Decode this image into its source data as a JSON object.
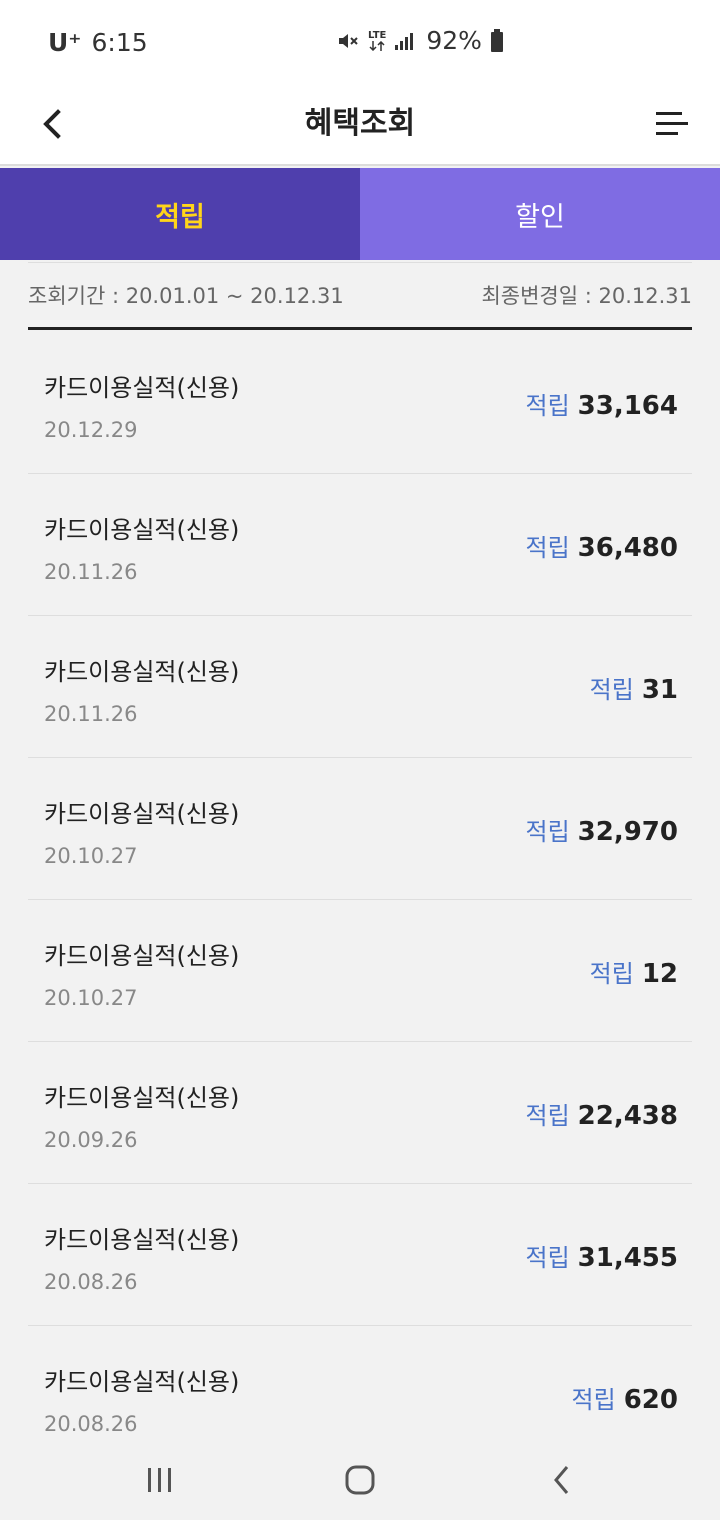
{
  "status_bar": {
    "carrier": "U⁺",
    "time": "6:15",
    "network": "LTE",
    "battery": "92%",
    "icons": [
      "mute-icon",
      "lte-icon",
      "signal-icon",
      "battery-icon"
    ]
  },
  "header": {
    "title": "혜택조회",
    "icons": [
      "back-icon",
      "menu-icon"
    ]
  },
  "tabs": [
    {
      "label": "적립",
      "active": true
    },
    {
      "label": "할인",
      "active": false
    }
  ],
  "period": {
    "range": "조회기간 : 20.01.01 ~ 20.12.31",
    "updated": "최종변경일 : 20.12.31"
  },
  "items": [
    {
      "title": "카드이용실적(신용)",
      "date": "20.12.29",
      "type": "적립",
      "amount": "33,164"
    },
    {
      "title": "카드이용실적(신용)",
      "date": "20.11.26",
      "type": "적립",
      "amount": "36,480"
    },
    {
      "title": "카드이용실적(신용)",
      "date": "20.11.26",
      "type": "적립",
      "amount": "31"
    },
    {
      "title": "카드이용실적(신용)",
      "date": "20.10.27",
      "type": "적립",
      "amount": "32,970"
    },
    {
      "title": "카드이용실적(신용)",
      "date": "20.10.27",
      "type": "적립",
      "amount": "12"
    },
    {
      "title": "카드이용실적(신용)",
      "date": "20.09.26",
      "type": "적립",
      "amount": "22,438"
    },
    {
      "title": "카드이용실적(신용)",
      "date": "20.08.26",
      "type": "적립",
      "amount": "31,455"
    },
    {
      "title": "카드이용실적(신용)",
      "date": "20.08.26",
      "type": "적립",
      "amount": "620"
    }
  ],
  "nav_bar": {
    "icons": [
      "recent-apps-icon",
      "home-icon",
      "nav-back-icon"
    ]
  },
  "colors": {
    "tab_active_bg": "#4f3fad",
    "tab_active_text": "#ffd51a",
    "tab_inactive_bg": "#7f6ce3",
    "amount_label": "#4a74c9"
  }
}
